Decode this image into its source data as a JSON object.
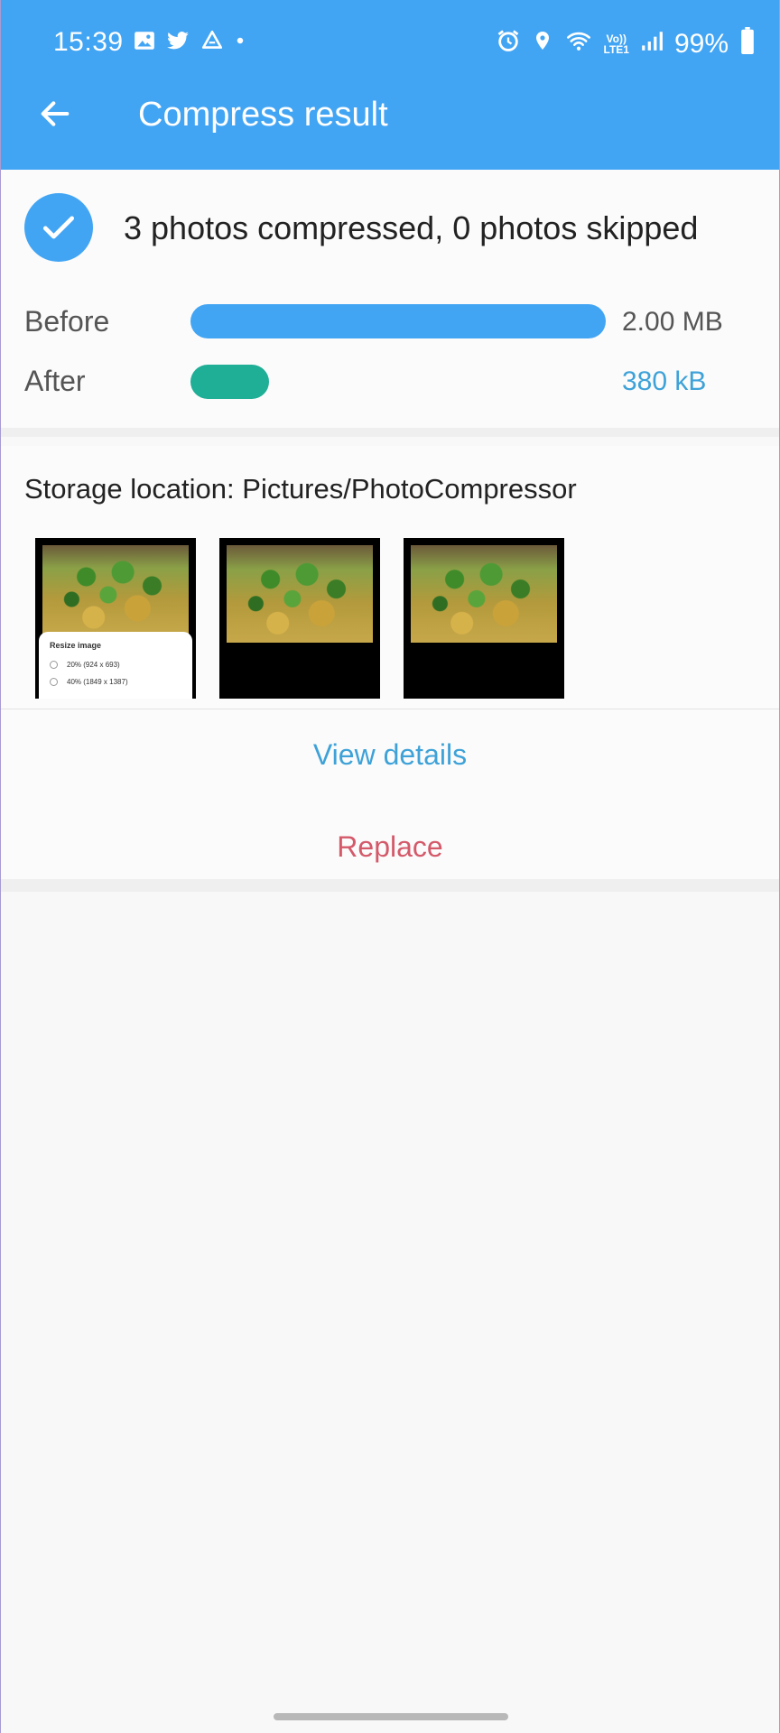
{
  "status_bar": {
    "time": "15:39",
    "lte": "LTE1",
    "volte": "Vo))",
    "battery": "99%"
  },
  "app_bar": {
    "title": "Compress result",
    "back_icon": "arrow-back-icon",
    "color": "#42a5f4"
  },
  "summary": {
    "text": "3 photos compressed, 0 photos skipped",
    "before_label": "Before",
    "before_value": "2.00 MB",
    "after_label": "After",
    "after_value": "380 kB",
    "after_fraction_of_before": 0.19,
    "before_color": "#42a5f4",
    "after_color": "#1fae96"
  },
  "storage": {
    "text": "Storage location: Pictures/PhotoCompressor",
    "thumbnail_dialog": {
      "title": "Resize image",
      "options": [
        "20% (924 x 693)",
        "40% (1849 x 1387)"
      ]
    }
  },
  "actions": {
    "view_details": "View details",
    "replace": "Replace"
  }
}
